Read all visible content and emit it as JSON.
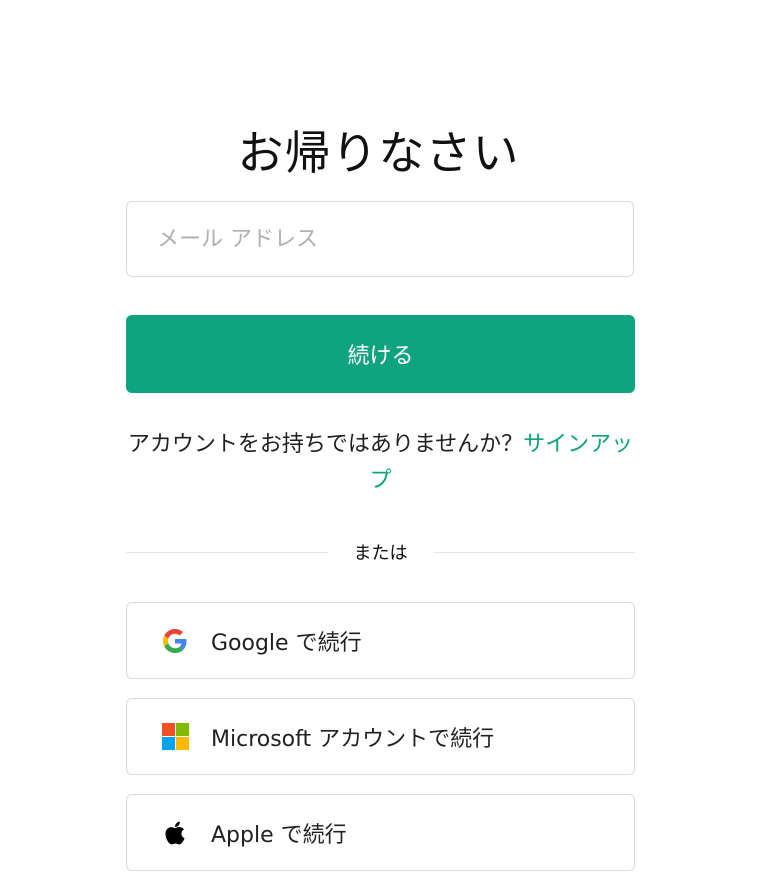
{
  "header": {
    "title": "お帰りなさい"
  },
  "login_form": {
    "email_placeholder": "メール アドレス",
    "email_value": "",
    "continue_label": "続ける"
  },
  "signup": {
    "prompt_text": "アカウントをお持ちではありませんか？",
    "link_text": "サインアップ"
  },
  "divider": {
    "label": "または"
  },
  "social_logins": [
    {
      "provider": "google",
      "icon": "google-icon",
      "label": "Google で続行"
    },
    {
      "provider": "microsoft",
      "icon": "microsoft-icon",
      "label": "Microsoft アカウントで続行"
    },
    {
      "provider": "apple",
      "icon": "apple-icon",
      "label": "Apple で続行"
    }
  ],
  "colors": {
    "accent": "#10a37f",
    "border": "#d9d9e3",
    "placeholder": "#aeb0b6",
    "google_blue": "#4285F4",
    "google_red": "#EA4335",
    "google_yellow": "#FBBC05",
    "google_green": "#34A853",
    "ms_red": "#F25022",
    "ms_green": "#7FBA00",
    "ms_blue": "#00A4EF",
    "ms_yellow": "#FFB900"
  }
}
